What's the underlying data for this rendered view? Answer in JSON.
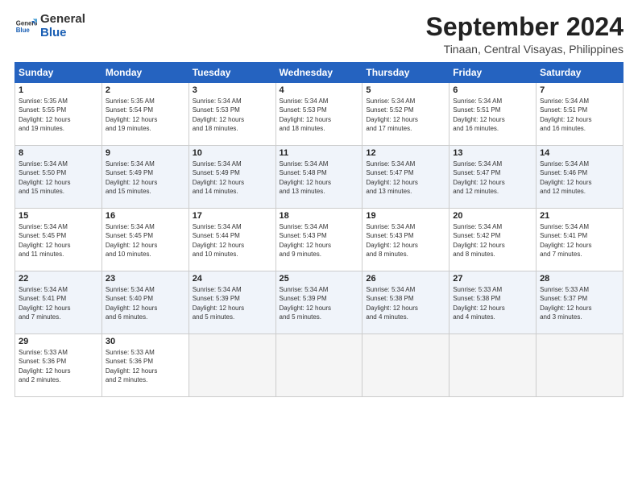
{
  "logo": {
    "line1": "General",
    "line2": "Blue"
  },
  "title": "September 2024",
  "location": "Tinaan, Central Visayas, Philippines",
  "days_of_week": [
    "Sunday",
    "Monday",
    "Tuesday",
    "Wednesday",
    "Thursday",
    "Friday",
    "Saturday"
  ],
  "weeks": [
    [
      {
        "day": "1",
        "sunrise": "5:35 AM",
        "sunset": "5:55 PM",
        "daylight": "12 hours and 19 minutes."
      },
      {
        "day": "2",
        "sunrise": "5:35 AM",
        "sunset": "5:54 PM",
        "daylight": "12 hours and 19 minutes."
      },
      {
        "day": "3",
        "sunrise": "5:34 AM",
        "sunset": "5:53 PM",
        "daylight": "12 hours and 18 minutes."
      },
      {
        "day": "4",
        "sunrise": "5:34 AM",
        "sunset": "5:53 PM",
        "daylight": "12 hours and 18 minutes."
      },
      {
        "day": "5",
        "sunrise": "5:34 AM",
        "sunset": "5:52 PM",
        "daylight": "12 hours and 17 minutes."
      },
      {
        "day": "6",
        "sunrise": "5:34 AM",
        "sunset": "5:51 PM",
        "daylight": "12 hours and 16 minutes."
      },
      {
        "day": "7",
        "sunrise": "5:34 AM",
        "sunset": "5:51 PM",
        "daylight": "12 hours and 16 minutes."
      }
    ],
    [
      {
        "day": "8",
        "sunrise": "5:34 AM",
        "sunset": "5:50 PM",
        "daylight": "12 hours and 15 minutes."
      },
      {
        "day": "9",
        "sunrise": "5:34 AM",
        "sunset": "5:49 PM",
        "daylight": "12 hours and 15 minutes."
      },
      {
        "day": "10",
        "sunrise": "5:34 AM",
        "sunset": "5:49 PM",
        "daylight": "12 hours and 14 minutes."
      },
      {
        "day": "11",
        "sunrise": "5:34 AM",
        "sunset": "5:48 PM",
        "daylight": "12 hours and 13 minutes."
      },
      {
        "day": "12",
        "sunrise": "5:34 AM",
        "sunset": "5:47 PM",
        "daylight": "12 hours and 13 minutes."
      },
      {
        "day": "13",
        "sunrise": "5:34 AM",
        "sunset": "5:47 PM",
        "daylight": "12 hours and 12 minutes."
      },
      {
        "day": "14",
        "sunrise": "5:34 AM",
        "sunset": "5:46 PM",
        "daylight": "12 hours and 12 minutes."
      }
    ],
    [
      {
        "day": "15",
        "sunrise": "5:34 AM",
        "sunset": "5:45 PM",
        "daylight": "12 hours and 11 minutes."
      },
      {
        "day": "16",
        "sunrise": "5:34 AM",
        "sunset": "5:45 PM",
        "daylight": "12 hours and 10 minutes."
      },
      {
        "day": "17",
        "sunrise": "5:34 AM",
        "sunset": "5:44 PM",
        "daylight": "12 hours and 10 minutes."
      },
      {
        "day": "18",
        "sunrise": "5:34 AM",
        "sunset": "5:43 PM",
        "daylight": "12 hours and 9 minutes."
      },
      {
        "day": "19",
        "sunrise": "5:34 AM",
        "sunset": "5:43 PM",
        "daylight": "12 hours and 8 minutes."
      },
      {
        "day": "20",
        "sunrise": "5:34 AM",
        "sunset": "5:42 PM",
        "daylight": "12 hours and 8 minutes."
      },
      {
        "day": "21",
        "sunrise": "5:34 AM",
        "sunset": "5:41 PM",
        "daylight": "12 hours and 7 minutes."
      }
    ],
    [
      {
        "day": "22",
        "sunrise": "5:34 AM",
        "sunset": "5:41 PM",
        "daylight": "12 hours and 7 minutes."
      },
      {
        "day": "23",
        "sunrise": "5:34 AM",
        "sunset": "5:40 PM",
        "daylight": "12 hours and 6 minutes."
      },
      {
        "day": "24",
        "sunrise": "5:34 AM",
        "sunset": "5:39 PM",
        "daylight": "12 hours and 5 minutes."
      },
      {
        "day": "25",
        "sunrise": "5:34 AM",
        "sunset": "5:39 PM",
        "daylight": "12 hours and 5 minutes."
      },
      {
        "day": "26",
        "sunrise": "5:34 AM",
        "sunset": "5:38 PM",
        "daylight": "12 hours and 4 minutes."
      },
      {
        "day": "27",
        "sunrise": "5:33 AM",
        "sunset": "5:38 PM",
        "daylight": "12 hours and 4 minutes."
      },
      {
        "day": "28",
        "sunrise": "5:33 AM",
        "sunset": "5:37 PM",
        "daylight": "12 hours and 3 minutes."
      }
    ],
    [
      {
        "day": "29",
        "sunrise": "5:33 AM",
        "sunset": "5:36 PM",
        "daylight": "12 hours and 2 minutes."
      },
      {
        "day": "30",
        "sunrise": "5:33 AM",
        "sunset": "5:36 PM",
        "daylight": "12 hours and 2 minutes."
      },
      null,
      null,
      null,
      null,
      null
    ]
  ],
  "labels": {
    "sunrise": "Sunrise:",
    "sunset": "Sunset:",
    "daylight": "Daylight:"
  }
}
